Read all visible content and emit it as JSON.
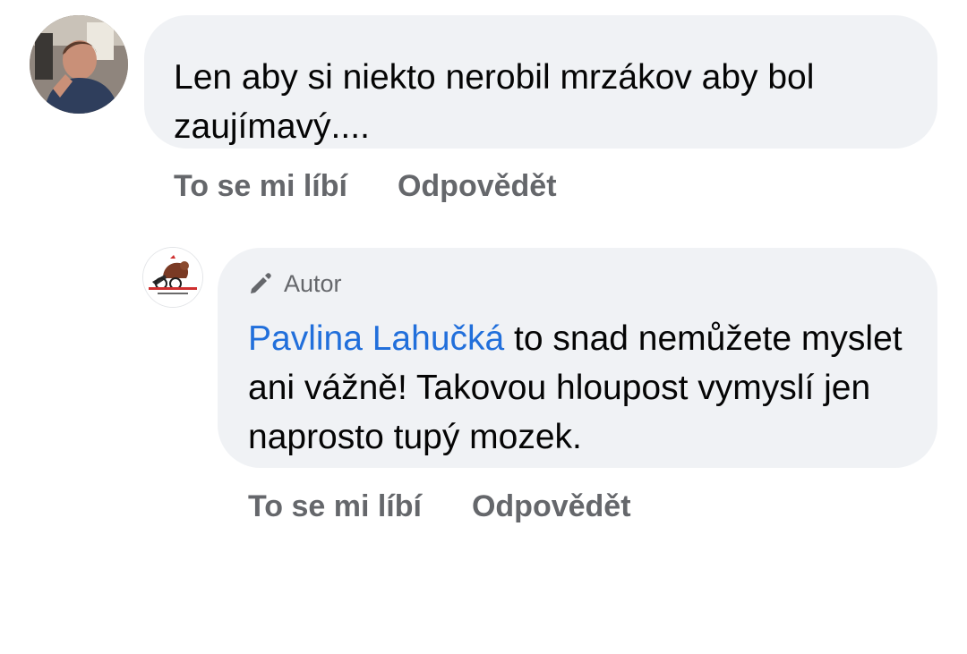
{
  "comments": [
    {
      "avatar": {
        "icon": "user-photo-avatar"
      },
      "text": "Len aby si niekto nerobil mrzákov aby bol zaujímavý....",
      "actions": {
        "like": "To se mi líbí",
        "reply": "Odpovědět"
      }
    },
    {
      "avatar": {
        "icon": "page-logo-avatar"
      },
      "author_badge": "Autor",
      "mention": "Pavlina Lahučká",
      "text": " to snad nemůžete myslet ani vážně! Takovou hloupost vymyslí jen naprosto tupý mozek.",
      "actions": {
        "like": "To se mi líbí",
        "reply": "Odpovědět"
      }
    }
  ],
  "colors": {
    "bubble_bg": "#f0f2f5",
    "text": "#050505",
    "secondary": "#65676b",
    "mention": "#216fdb"
  }
}
